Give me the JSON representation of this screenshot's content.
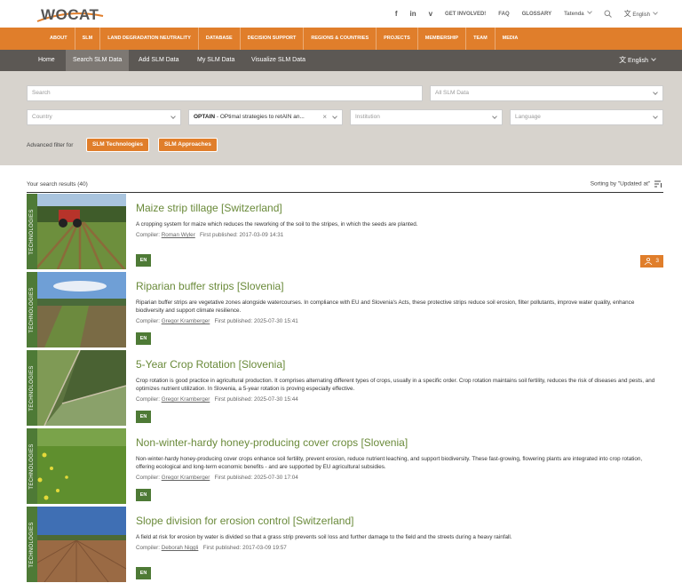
{
  "brand": {
    "logo": "WOCAT"
  },
  "topbar": {
    "social": [
      "f",
      "in",
      "v"
    ],
    "links": [
      "GET INVOLVED!",
      "FAQ",
      "GLOSSARY"
    ],
    "user": "Tatenda",
    "language": "English"
  },
  "main_nav": [
    "ABOUT",
    "SLM",
    "LAND DEGRADATION NEUTRALITY",
    "DATABASE",
    "DECISION SUPPORT",
    "REGIONS & COUNTRIES",
    "PROJECTS",
    "MEMBERSHIP",
    "TEAM",
    "MEDIA"
  ],
  "sub_nav": {
    "items": [
      "Home",
      "Search SLM Data",
      "Add SLM Data",
      "My SLM Data",
      "Visualize SLM Data"
    ],
    "active": "Search SLM Data",
    "language": "English"
  },
  "filters": {
    "search_placeholder": "Search",
    "data_type": "All SLM Data",
    "country": "Country",
    "project_bold": "OPTAIN",
    "project_rest": " - OPtimal strategies to retAIN an...",
    "institution": "Institution",
    "language": "Language",
    "advanced_label": "Advanced filter for",
    "advanced_buttons": [
      "SLM Technologies",
      "SLM Approaches"
    ]
  },
  "results": {
    "count_text": "Your search results (40)",
    "sorting_text": "Sorting by \"Updated at\"",
    "compiler_label": "Compiler:",
    "published_label": "First published:",
    "items": [
      {
        "type": "TECHNOLOGIES",
        "title": "Maize strip tillage [Switzerland]",
        "description": "A cropping system for maize which reduces the reworking of the soil to the stripes, in which the seeds are planted.",
        "compiler": "Roman Wyler",
        "published": "2017-03-09 14:31",
        "lang": "EN",
        "count": "3"
      },
      {
        "type": "TECHNOLOGIES",
        "title": "Riparian buffer strips [Slovenia]",
        "description": "Riparian buffer strips are vegetative zones alongside watercourses. In compliance with EU and Slovenia's Acts, these protective strips reduce soil erosion, filter pollutants, improve water quality, enhance biodiversity and support climate resilience.",
        "compiler": "Gregor Kramberger",
        "published": "2025-07-30 15:41",
        "lang": "EN"
      },
      {
        "type": "TECHNOLOGIES",
        "title": "5-Year Crop Rotation [Slovenia]",
        "description": "Crop rotation is good practice in agricultural production. It comprises alternating different types of crops, usually in a specific order. Crop rotation maintains soil fertility, reduces the risk of diseases and pests, and optimizes nutrient utilization. In Slovenia, a 5-year rotation is proving especially effective.",
        "compiler": "Gregor Kramberger",
        "published": "2025-07-30 15:44",
        "lang": "EN"
      },
      {
        "type": "TECHNOLOGIES",
        "title": "Non-winter-hardy honey-producing cover crops [Slovenia]",
        "description": "Non-winter-hardy honey-producing cover crops enhance soil fertility, prevent erosion, reduce nutrient leaching, and support biodiversity. These fast-growing, flowering plants are integrated into crop rotation, offering ecological and long-term economic benefits - and are supported by EU agricultural subsidies.",
        "compiler": "Gregor Kramberger",
        "published": "2025-07-30 17:04",
        "lang": "EN"
      },
      {
        "type": "TECHNOLOGIES",
        "title": "Slope division for erosion control [Switzerland]",
        "description": "A field at risk for erosion by water is divided so that a grass strip prevents soil loss and further damage to the field and the streets during a heavy rainfall.",
        "compiler": "Deborah Niggli",
        "published": "2017-03-09 19:57",
        "lang": "EN"
      }
    ]
  }
}
